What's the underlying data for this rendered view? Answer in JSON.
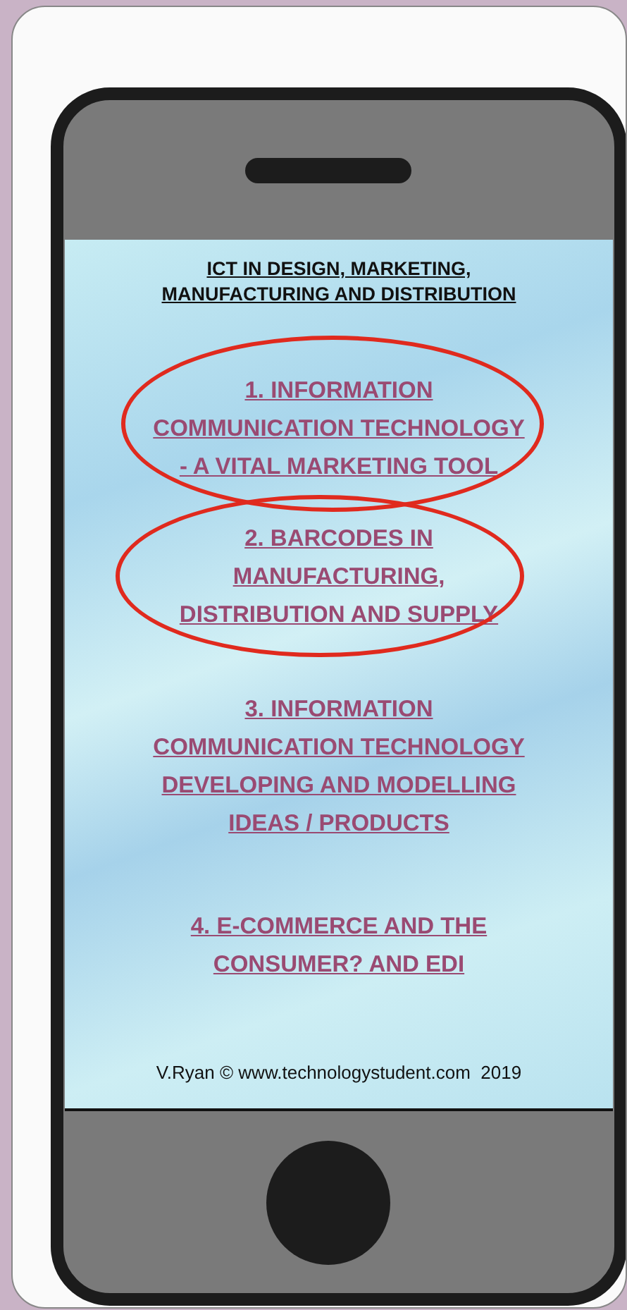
{
  "page": {
    "title_lines": [
      "ICT IN DESIGN, MARKETING,",
      "MANUFACTURING AND DISTRIBUTION"
    ],
    "links": [
      {
        "lines": [
          "1. INFORMATION",
          "COMMUNICATION TECHNOLOGY",
          "- A VITAL MARKETING TOOL"
        ],
        "circled": true
      },
      {
        "lines": [
          "2. BARCODES IN",
          "MANUFACTURING,",
          "DISTRIBUTION AND SUPPLY"
        ],
        "circled": true
      },
      {
        "lines": [
          "3. INFORMATION",
          "COMMUNICATION TECHNOLOGY",
          "DEVELOPING AND MODELLING",
          "IDEAS / PRODUCTS"
        ],
        "circled": false
      },
      {
        "lines": [
          "4. E-COMMERCE AND THE",
          "CONSUMER? AND EDI"
        ],
        "circled": false
      }
    ],
    "footer": "V.Ryan © www.technologystudent.com  2019"
  }
}
